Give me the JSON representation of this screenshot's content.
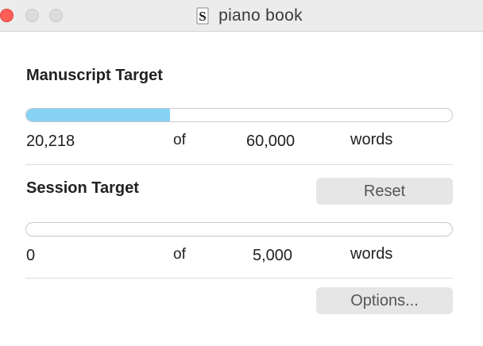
{
  "window": {
    "title": "piano book",
    "app_icon": "scrivener-s-icon"
  },
  "manuscript": {
    "heading": "Manuscript Target",
    "current": "20,218",
    "of_label": "of",
    "target": "60,000",
    "unit": "words",
    "progress_fraction": 0.337
  },
  "session": {
    "heading": "Session Target",
    "reset_label": "Reset",
    "current": "0",
    "of_label": "of",
    "target": "5,000",
    "unit": "words",
    "progress_fraction": 0
  },
  "footer": {
    "options_label": "Options..."
  },
  "colors": {
    "progress_fill": "#86d3f5",
    "close_button": "#fe5f57"
  }
}
